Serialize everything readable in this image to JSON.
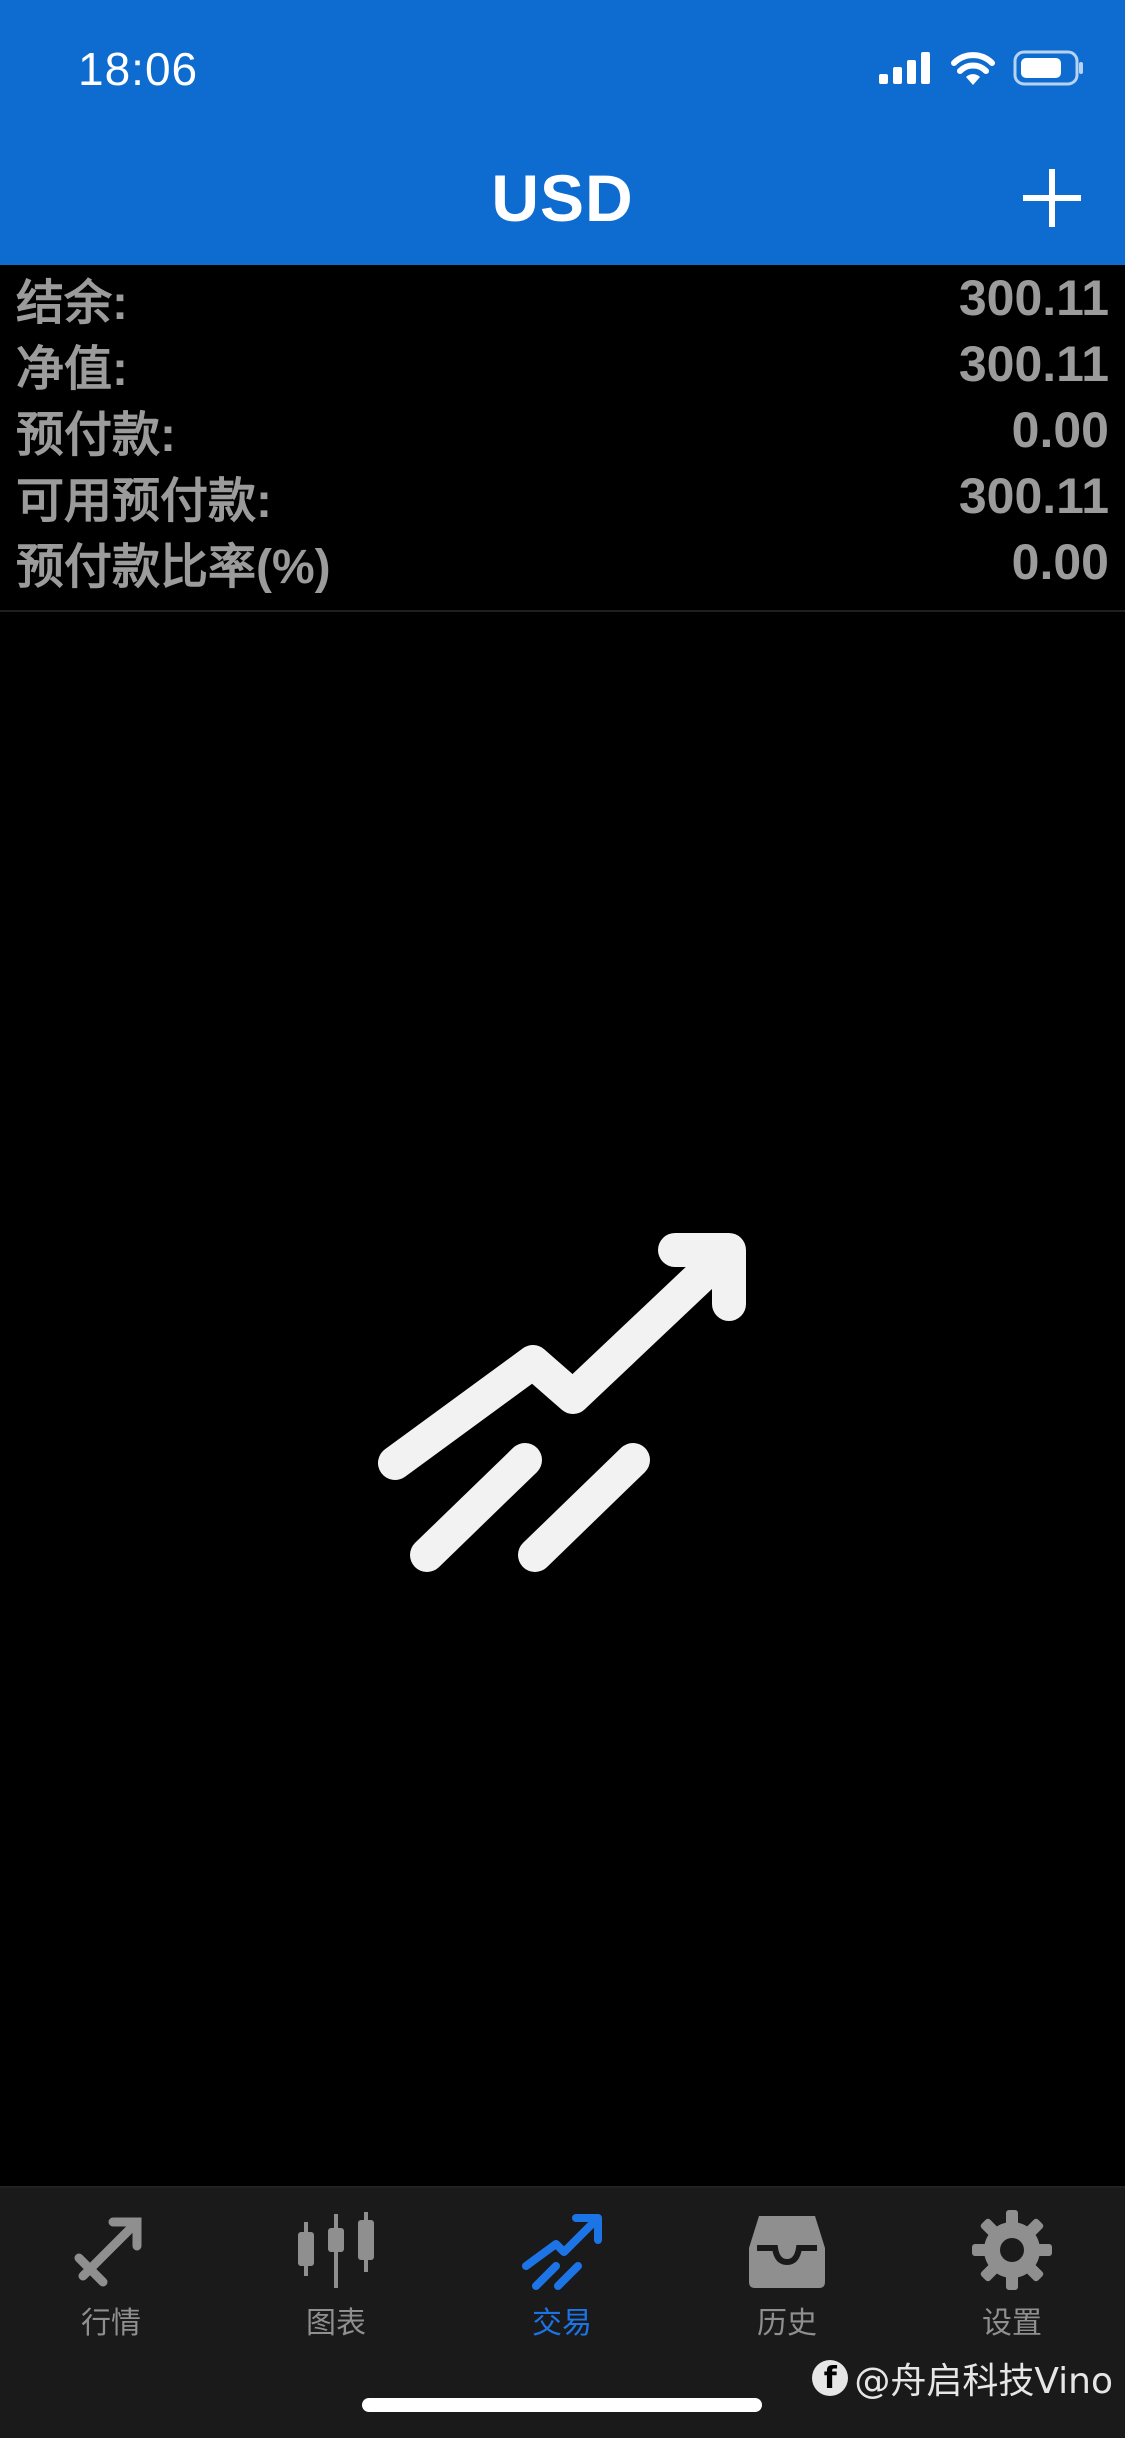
{
  "status_bar": {
    "time": "18:06"
  },
  "header": {
    "title": "USD"
  },
  "account": {
    "rows": [
      {
        "label": "结余:",
        "value": "300.11"
      },
      {
        "label": "净值:",
        "value": "300.11"
      },
      {
        "label": "预付款:",
        "value": "0.00"
      },
      {
        "label": "可用预付款:",
        "value": "300.11"
      },
      {
        "label": "预付款比率(%)",
        "value": "0.00"
      }
    ]
  },
  "tabs": [
    {
      "label": "行情",
      "icon": "quotes-icon",
      "active": false
    },
    {
      "label": "图表",
      "icon": "chart-icon",
      "active": false
    },
    {
      "label": "交易",
      "icon": "trade-icon",
      "active": true
    },
    {
      "label": "历史",
      "icon": "history-icon",
      "active": false
    },
    {
      "label": "设置",
      "icon": "settings-icon",
      "active": false
    }
  ],
  "watermark": {
    "text": "@舟启科技Vino"
  },
  "colors": {
    "header_bg": "#0e6bd0",
    "active_tab": "#1d74e6",
    "inactive_tab": "#8f8f8f"
  }
}
